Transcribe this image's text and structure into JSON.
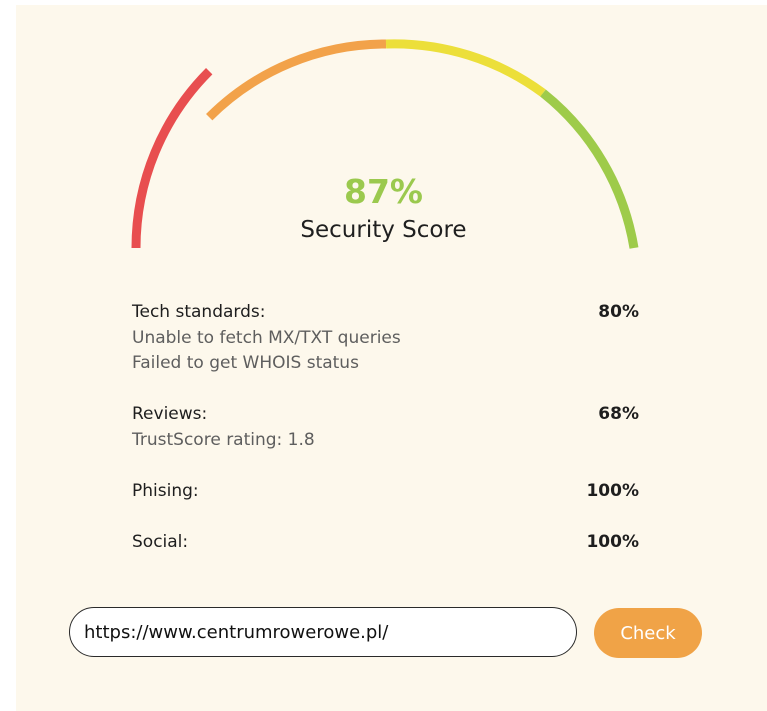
{
  "gauge": {
    "score_text": "87%",
    "score_value": 87,
    "label": "Security Score",
    "segment_colors": [
      "#e84e4f",
      "#f2a24a",
      "#ecdf3a",
      "#9ecb4a"
    ]
  },
  "metrics": [
    {
      "title": "Tech standards:",
      "percent": "80%",
      "details": [
        "Unable to fetch MX/TXT queries",
        "Failed to get WHOIS status"
      ]
    },
    {
      "title": "Reviews:",
      "percent": "68%",
      "details": [
        "TrustScore rating: 1.8"
      ]
    },
    {
      "title": "Phising:",
      "percent": "100%",
      "details": []
    },
    {
      "title": "Social:",
      "percent": "100%",
      "details": []
    }
  ],
  "url_input": {
    "value": "https://www.centrumrowerowe.pl/"
  },
  "check_button": {
    "label": "Check"
  },
  "colors": {
    "background": "#fdf8ec",
    "accent_button": "#f0a347",
    "score_green": "#9bc94e"
  }
}
